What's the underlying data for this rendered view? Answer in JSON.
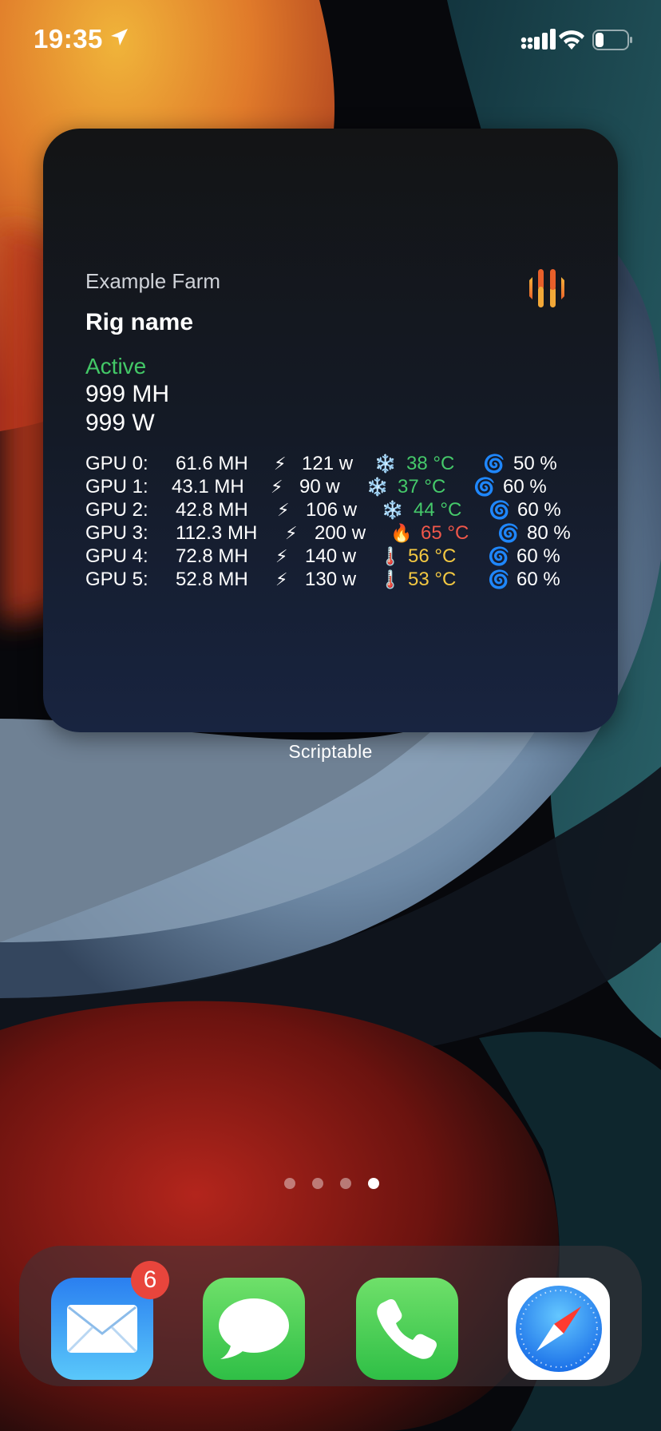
{
  "status_bar": {
    "time": "19:35"
  },
  "widget": {
    "farm_name": "Example Farm",
    "rig_name": "Rig name",
    "status": "Active",
    "hashrate": "999 MH",
    "power": "999 W",
    "gpus": [
      {
        "label": "GPU 0:",
        "hashrate": "61.6 MH",
        "power_icon": "⚡",
        "power": "121 w",
        "temp_icon": "❄️",
        "temp": "38 °C",
        "fan_icon": "🌀",
        "fan": "50 %"
      },
      {
        "label": "GPU 1:",
        "hashrate": "43.1 MH",
        "power_icon": "⚡",
        "power": "90 w",
        "temp_icon": "❄️",
        "temp": "37 °C",
        "fan_icon": "🌀",
        "fan": "60 %"
      },
      {
        "label": "GPU 2:",
        "hashrate": "42.8 MH",
        "power_icon": "⚡",
        "power": "106 w",
        "temp_icon": "❄️",
        "temp": "44 °C",
        "fan_icon": "🌀",
        "fan": "60 %"
      },
      {
        "label": "GPU 3:",
        "hashrate": "112.3 MH",
        "power_icon": "⚡",
        "power": "200 w",
        "temp_icon": "🔥",
        "temp": "65 °C",
        "fan_icon": "🌀",
        "fan": "80 %"
      },
      {
        "label": "GPU 4:",
        "hashrate": "72.8 MH",
        "power_icon": "⚡",
        "power": "140 w",
        "temp_icon": "🌡️",
        "temp": "56 °C",
        "fan_icon": "🌀",
        "fan": "60 %"
      },
      {
        "label": "GPU 5:",
        "hashrate": "52.8 MH",
        "power_icon": "⚡",
        "power": "130 w",
        "temp_icon": "🌡️",
        "temp": "53 °C",
        "fan_icon": "🌀",
        "fan": "60 %"
      }
    ],
    "caption": "Scriptable"
  },
  "home": {
    "page_count": 4,
    "current_page": 4
  },
  "dock": {
    "apps": [
      {
        "name": "mail-app",
        "icon": "envelope-icon",
        "badge": "6"
      },
      {
        "name": "messages-app",
        "icon": "speech-bubble-icon"
      },
      {
        "name": "phone-app",
        "icon": "phone-handset-icon"
      },
      {
        "name": "safari-app",
        "icon": "compass-icon"
      }
    ]
  },
  "colors": {
    "status_active": "#43c867",
    "temp_cool": "#45c96a",
    "temp_hot": "#f0574a",
    "temp_warm": "#f3c842",
    "badge": "#e8453c"
  }
}
